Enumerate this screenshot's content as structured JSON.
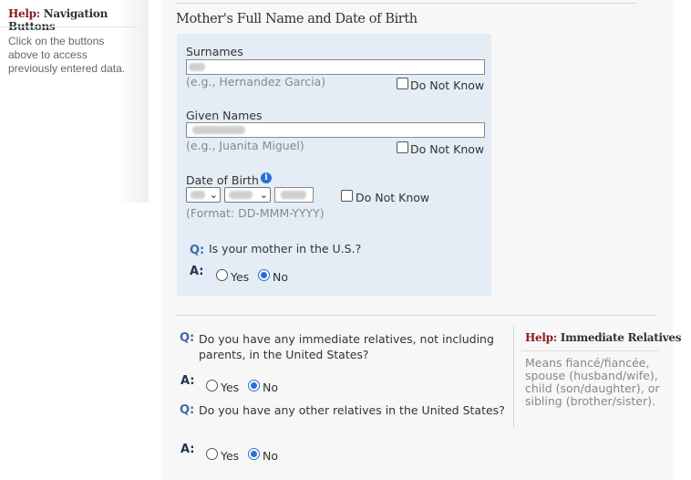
{
  "nav_help": {
    "prefix": "Help:",
    "title": "Navigation Buttons",
    "text": "Click on the buttons above to access previously entered data."
  },
  "section": {
    "title": "Mother's Full Name and Date of Birth"
  },
  "surnames": {
    "label": "Surnames",
    "hint": "(e.g., Hernandez Garcia)",
    "do_not_know": "Do Not Know"
  },
  "given_names": {
    "label": "Given Names",
    "hint": "(e.g., Juanita Miguel)",
    "do_not_know": "Do Not Know"
  },
  "dob": {
    "label": "Date of Birth",
    "info_icon": "info-icon",
    "format_hint": "(Format: DD-MMM-YYYY)",
    "do_not_know": "Do Not Know"
  },
  "q_mother_in_us": {
    "q_marker": "Q:",
    "question": "Is your mother in the U.S.?",
    "a_marker": "A:",
    "options": [
      "Yes",
      "No"
    ],
    "selected": "No"
  },
  "q_immediate_relatives": {
    "q_marker": "Q:",
    "question": "Do you have any immediate relatives, not including parents, in the United States?",
    "a_marker": "A:",
    "options": [
      "Yes",
      "No"
    ],
    "selected": "No"
  },
  "q_other_relatives": {
    "q_marker": "Q:",
    "question": "Do you have any other relatives in the United States?",
    "a_marker": "A:",
    "options": [
      "Yes",
      "No"
    ],
    "selected": "No"
  },
  "relatives_help": {
    "prefix": "Help:",
    "title": "Immediate Relatives",
    "text": "Means fiancé/fiancée, spouse (husband/wife), child (son/daughter), or sibling (brother/sister)."
  }
}
